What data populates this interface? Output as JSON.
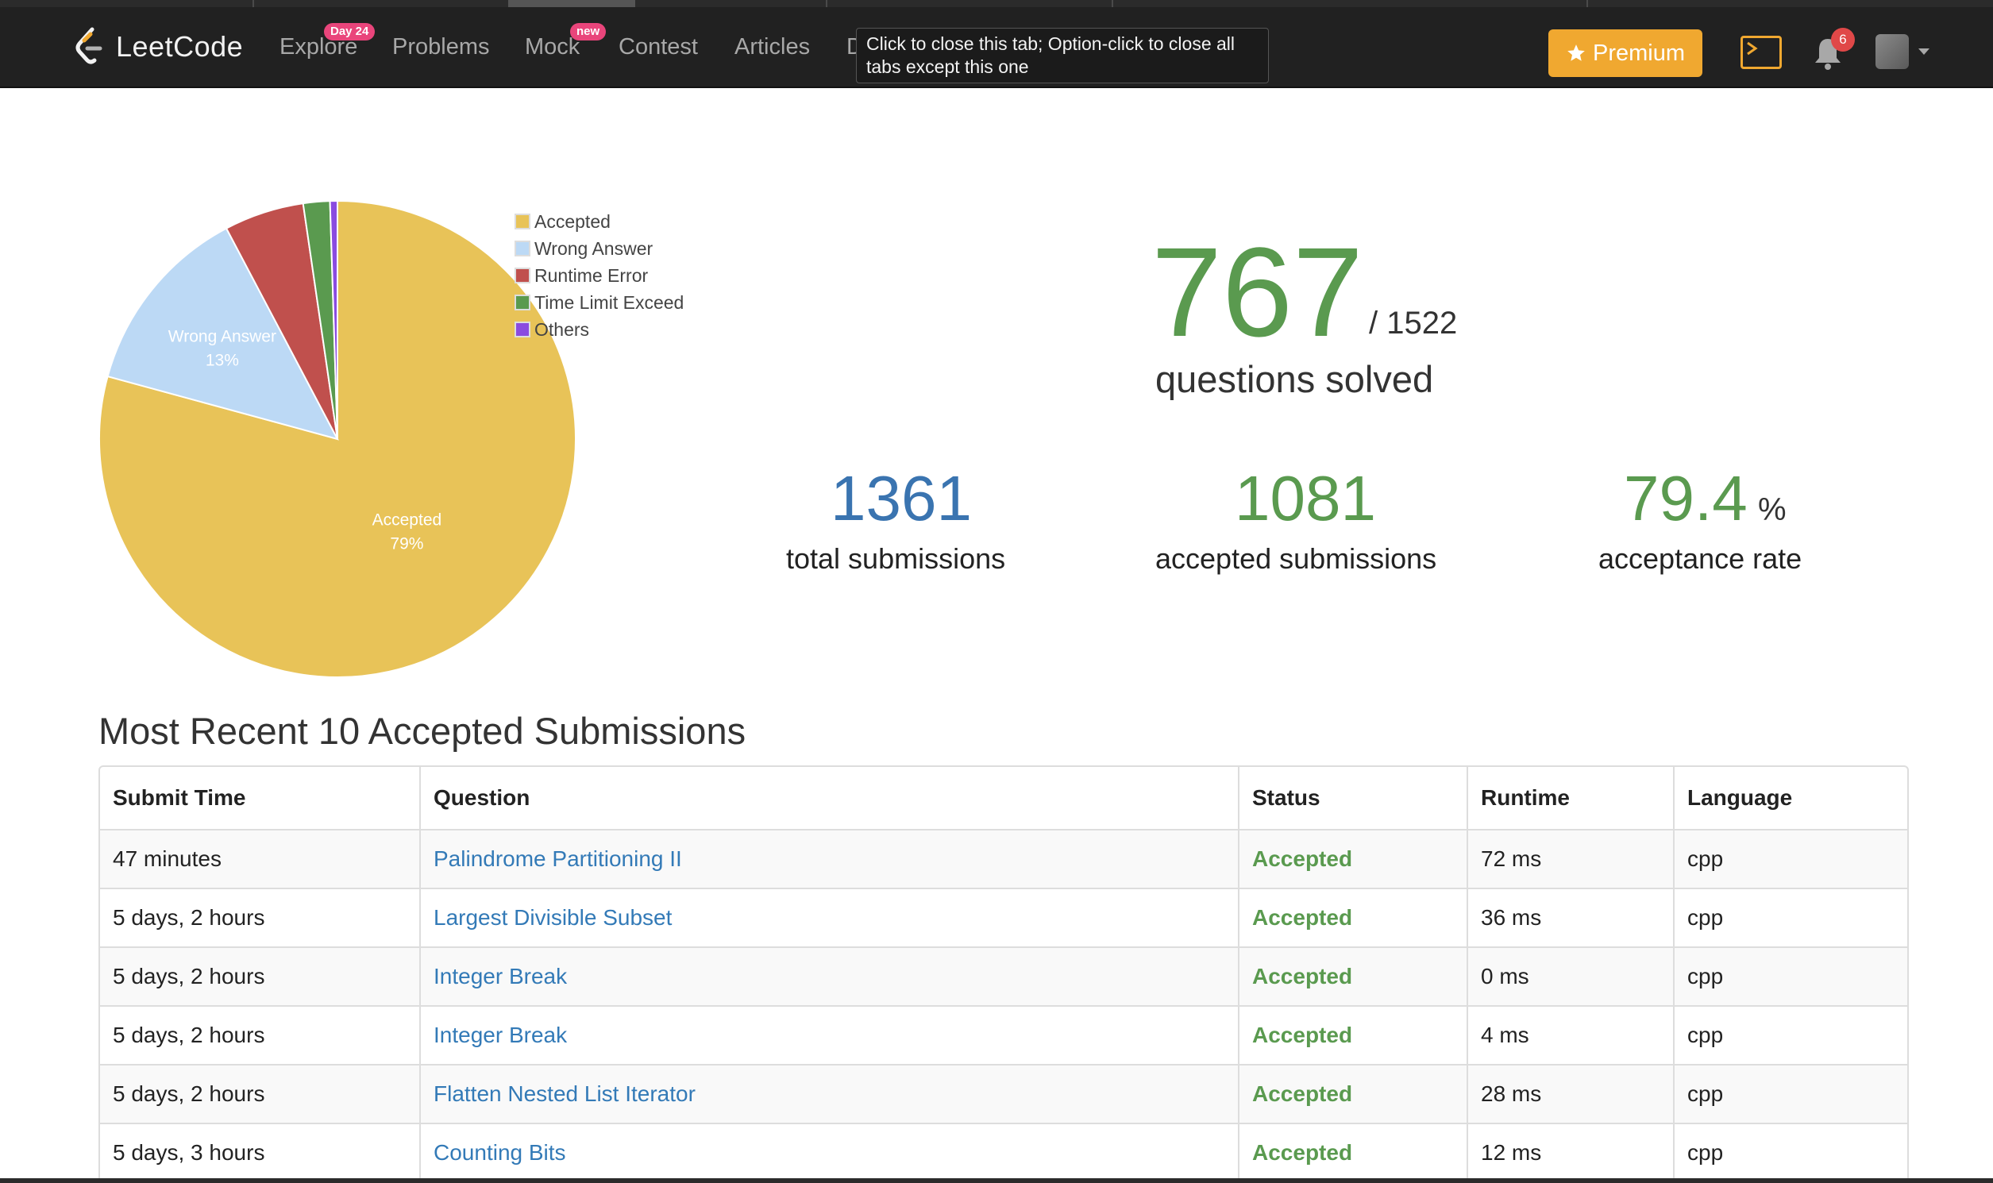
{
  "navbar": {
    "brand": "LeetCode",
    "links": [
      {
        "label": "Explore",
        "badge": "Day 24"
      },
      {
        "label": "Problems"
      },
      {
        "label": "Mock",
        "badge": "new"
      },
      {
        "label": "Contest"
      },
      {
        "label": "Articles"
      },
      {
        "label": "D"
      }
    ],
    "tooltip": "Click to close this tab; Option-click to close all tabs except this one",
    "premium_label": "Premium",
    "notification_count": "6",
    "icons": [
      "leetcode-logo-icon",
      "star-icon",
      "terminal-icon",
      "bell-icon",
      "avatar",
      "caret-down-icon"
    ]
  },
  "chart_data": {
    "type": "pie",
    "slices": [
      {
        "name": "Accepted",
        "value": 79,
        "color": "#e8c358",
        "label": "Accepted",
        "label_pct": "79%"
      },
      {
        "name": "Wrong Answer",
        "value": 13,
        "color": "#bcd9f5",
        "label": "Wrong Answer",
        "label_pct": "13%"
      },
      {
        "name": "Runtime Error",
        "value": 5.4,
        "color": "#c0504d",
        "label": "",
        "label_pct": ""
      },
      {
        "name": "Time Limit Exceed",
        "value": 1.8,
        "color": "#5a9a4f",
        "label": "",
        "label_pct": ""
      },
      {
        "name": "Others",
        "value": 0.5,
        "color": "#8a4be0",
        "label": "",
        "label_pct": ""
      }
    ],
    "legend": [
      "Accepted",
      "Wrong Answer",
      "Runtime Error",
      "Time Limit Exceed",
      "Others"
    ],
    "legend_position": "top-right"
  },
  "stats": {
    "solved": "767",
    "total_questions": "/ 1522",
    "solved_label": "questions solved",
    "total_submissions": "1361",
    "total_submissions_label": "total submissions",
    "accepted_submissions": "1081",
    "accepted_submissions_label": "accepted submissions",
    "acceptance_rate": "79.4",
    "acceptance_pct_sign": "%",
    "acceptance_rate_label": "acceptance rate",
    "colors": {
      "green": "#5a9a4f",
      "blue": "#3a74b0"
    }
  },
  "recent": {
    "title": "Most Recent 10 Accepted Submissions",
    "columns": [
      "Submit Time",
      "Question",
      "Status",
      "Runtime",
      "Language"
    ],
    "rows": [
      {
        "time": "47 minutes",
        "question": "Palindrome Partitioning II",
        "status": "Accepted",
        "runtime": "72 ms",
        "language": "cpp"
      },
      {
        "time": "5 days, 2 hours",
        "question": "Largest Divisible Subset",
        "status": "Accepted",
        "runtime": "36 ms",
        "language": "cpp"
      },
      {
        "time": "5 days, 2 hours",
        "question": "Integer Break",
        "status": "Accepted",
        "runtime": "0 ms",
        "language": "cpp"
      },
      {
        "time": "5 days, 2 hours",
        "question": "Integer Break",
        "status": "Accepted",
        "runtime": "4 ms",
        "language": "cpp"
      },
      {
        "time": "5 days, 2 hours",
        "question": "Flatten Nested List Iterator",
        "status": "Accepted",
        "runtime": "28 ms",
        "language": "cpp"
      },
      {
        "time": "5 days, 3 hours",
        "question": "Counting Bits",
        "status": "Accepted",
        "runtime": "12 ms",
        "language": "cpp"
      }
    ]
  }
}
